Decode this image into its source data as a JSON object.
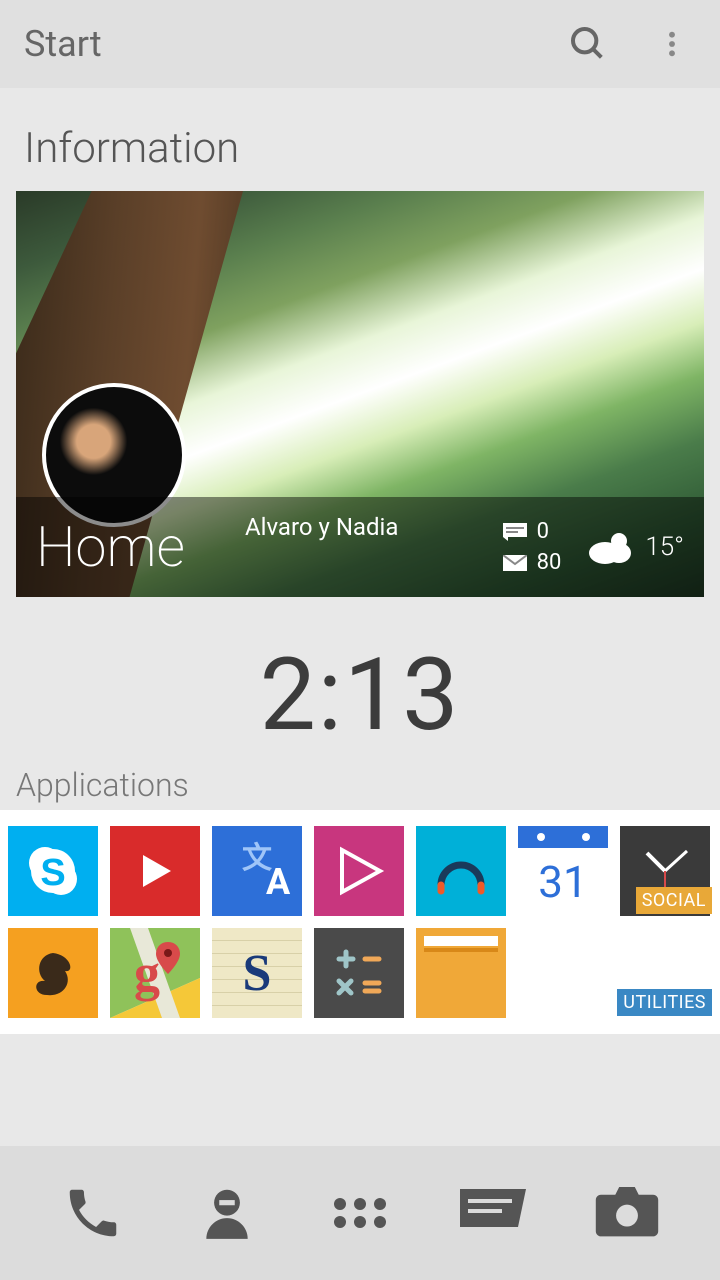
{
  "topbar": {
    "title": "Start",
    "search_name": "search-icon",
    "menu_name": "more-vertical-icon"
  },
  "section_info": "Information",
  "card": {
    "home_label": "Home",
    "owner": "Alvaro y Nadia",
    "sms_count": "0",
    "mail_count": "80",
    "temp": "15°"
  },
  "clock": "2:13",
  "section_apps": "Applications",
  "apps": [
    {
      "name": "skype"
    },
    {
      "name": "youtube"
    },
    {
      "name": "translate"
    },
    {
      "name": "play-store"
    },
    {
      "name": "music"
    },
    {
      "name": "calendar",
      "day": "31"
    },
    {
      "name": "clock"
    },
    {
      "name": "soundhound"
    },
    {
      "name": "maps"
    },
    {
      "name": "notes",
      "letter": "S"
    },
    {
      "name": "calculator"
    },
    {
      "name": "files"
    }
  ],
  "badges": {
    "social": "SOCIAL",
    "utilities": "UTILITIES"
  },
  "dock": [
    {
      "name": "phone"
    },
    {
      "name": "contacts"
    },
    {
      "name": "apps-grid"
    },
    {
      "name": "messages"
    },
    {
      "name": "camera"
    }
  ]
}
